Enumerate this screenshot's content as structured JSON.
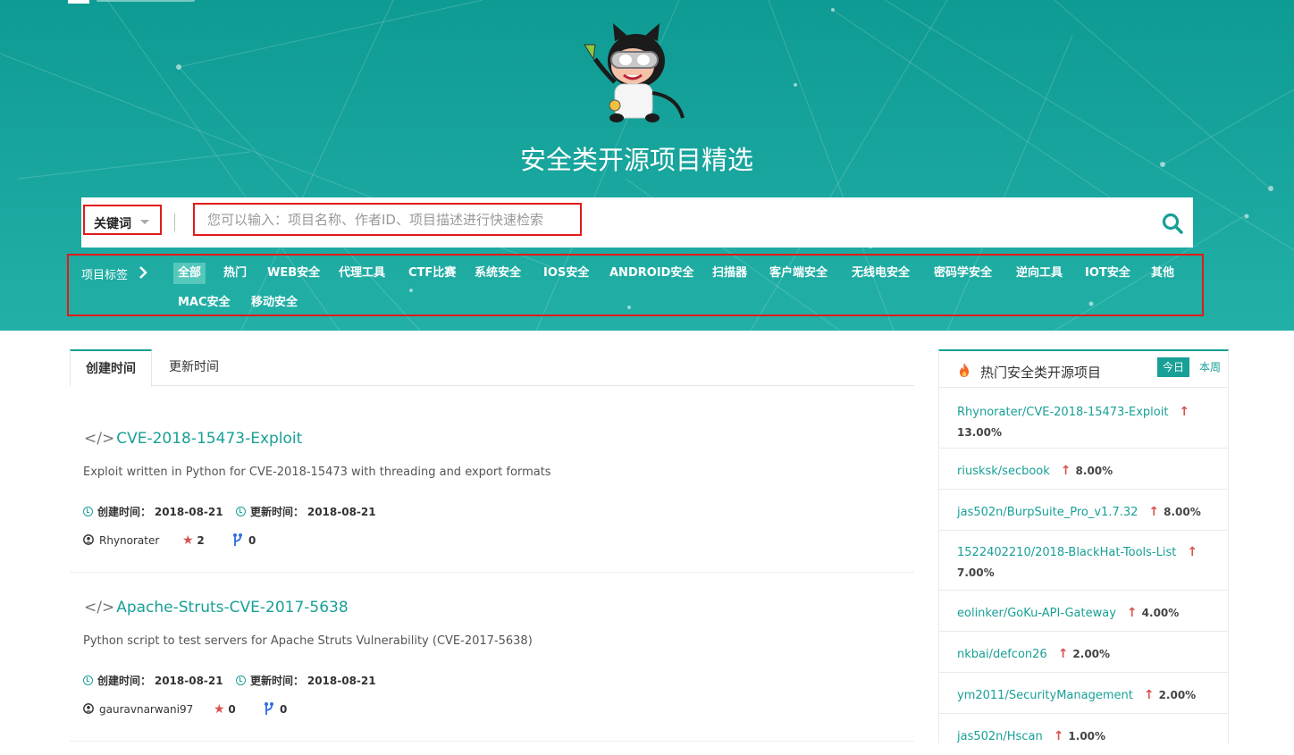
{
  "hero": {
    "title": "安全类开源项目精选"
  },
  "search": {
    "filter_label": "关键词",
    "placeholder": "您可以输入：项目名称、作者ID、项目描述进行快速检索"
  },
  "tags": {
    "label": "项目标签",
    "items": [
      "全部",
      "热门",
      "WEB安全",
      "代理工具",
      "CTF比赛",
      "系统安全",
      "IOS安全",
      "ANDROID安全",
      "扫描器",
      "客户端安全",
      "无线电安全",
      "密码学安全",
      "逆向工具",
      "IOT安全",
      "其他",
      "MAC安全",
      "移动安全"
    ],
    "active": "全部"
  },
  "tabs": [
    "创建时间",
    "更新时间"
  ],
  "projects": [
    {
      "code": "</>",
      "name": "CVE-2018-15473-Exploit",
      "description": "Exploit written in Python for CVE-2018-15473 with threading and export formats",
      "created_label": "创建时间：",
      "created": "2018-08-21",
      "updated_label": "更新时间：",
      "updated": "2018-08-21",
      "author": "Rhynorater",
      "stars": "2",
      "forks": "0"
    },
    {
      "code": "</>",
      "name": "Apache-Struts-CVE-2017-5638",
      "description": "Python script to test servers for Apache Struts Vulnerability (CVE-2017-5638)",
      "created_label": "创建时间：",
      "created": "2018-08-21",
      "updated_label": "更新时间：",
      "updated": "2018-08-21",
      "author": "gauravnarwani97",
      "stars": "0",
      "forks": "0"
    }
  ],
  "sidebar": {
    "title": "热门安全类开源项目",
    "tab_today": "今日",
    "tab_week": "本周",
    "hot": [
      {
        "name": "Rhynorater/CVE-2018-15473-Exploit",
        "pct": "13.00%"
      },
      {
        "name": "riusksk/secbook",
        "pct": "8.00%"
      },
      {
        "name": "jas502n/BurpSuite_Pro_v1.7.32",
        "pct": "8.00%"
      },
      {
        "name": "1522402210/2018-BlackHat-Tools-List",
        "pct": "7.00%"
      },
      {
        "name": "eolinker/GoKu-API-Gateway",
        "pct": "4.00%"
      },
      {
        "name": "nkbai/defcon26",
        "pct": "2.00%"
      },
      {
        "name": "ym2011/SecurityManagement",
        "pct": "2.00%"
      },
      {
        "name": "jas502n/Hscan",
        "pct": "1.00%"
      }
    ],
    "arrow": "↑"
  },
  "colors": {
    "accent": "#18a096",
    "hero_bg": "#14a29a",
    "highlight_border": "#e21a1a",
    "up_arrow": "#d9534f"
  }
}
